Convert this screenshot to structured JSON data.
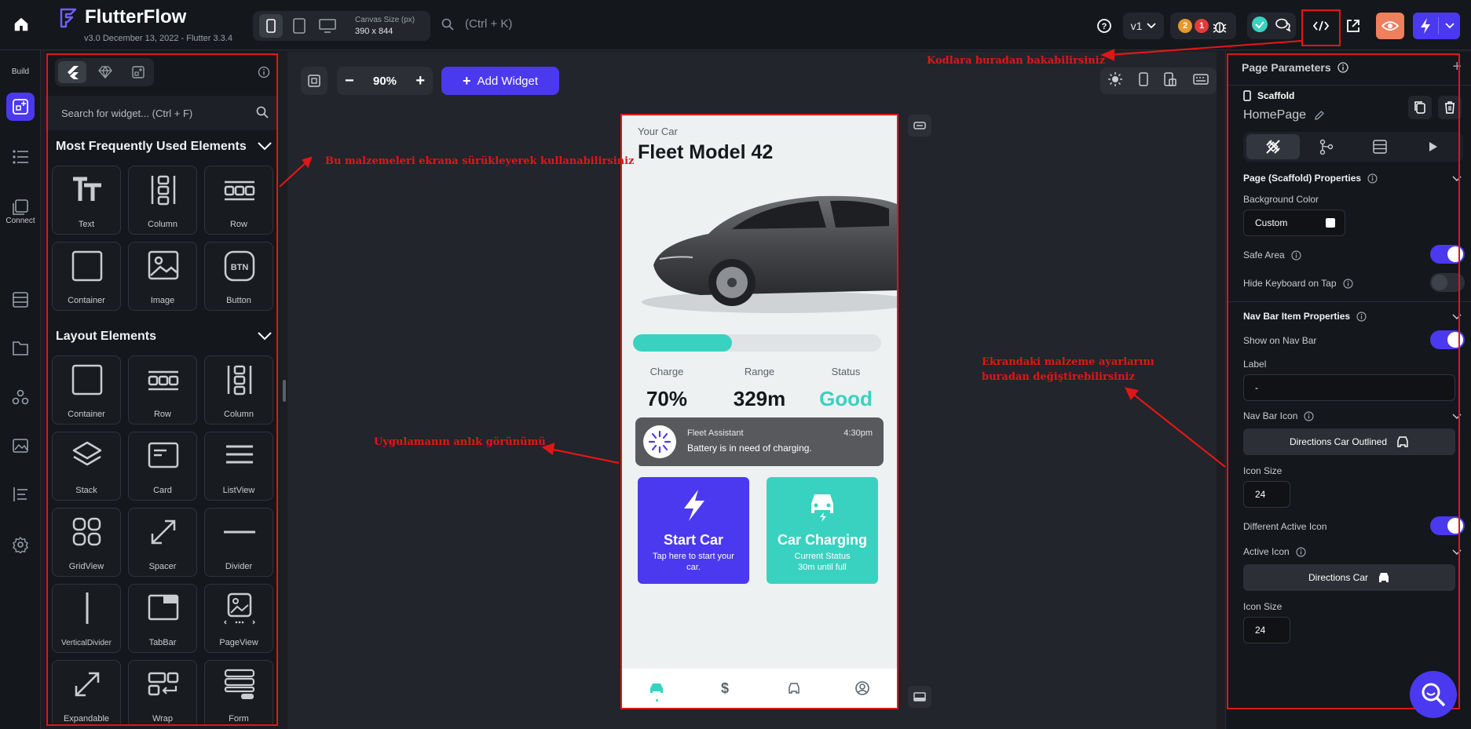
{
  "app": {
    "name": "FlutterFlow",
    "version": "v3.0 December 13, 2022 - Flutter 3.3.4"
  },
  "topbar": {
    "canvas_size_label": "Canvas Size (px)",
    "canvas_size_value": "390 x 844",
    "search_placeholder": "(Ctrl + K)",
    "version_pill": "v1",
    "warnings_count": "2",
    "errors_count": "1",
    "accent_color": "#4b39ef"
  },
  "rail": {
    "build_label": "Build",
    "connect_label": "Connect"
  },
  "widgets_panel": {
    "search_placeholder": "Search for widget...  (Ctrl + F)",
    "sections": [
      {
        "title": "Most Frequently Used Elements",
        "items": [
          "Text",
          "Column",
          "Row",
          "Container",
          "Image",
          "Button"
        ]
      },
      {
        "title": "Layout Elements",
        "items": [
          "Container",
          "Row",
          "Column",
          "Stack",
          "Card",
          "ListView",
          "GridView",
          "Spacer",
          "Divider",
          "VerticalDivider",
          "TabBar",
          "PageView",
          "Expandable",
          "Wrap",
          "Form"
        ]
      }
    ]
  },
  "canvas": {
    "zoom": "90%",
    "add_widget": "Add Widget"
  },
  "phone": {
    "subtitle": "Your Car",
    "title": "Fleet Model 42",
    "charge_progress_percent": 40,
    "stats": [
      {
        "label": "Charge",
        "value": "70%"
      },
      {
        "label": "Range",
        "value": "329m"
      },
      {
        "label": "Status",
        "value": "Good"
      }
    ],
    "notification": {
      "title": "Fleet Assistant",
      "time": "4:30pm",
      "message": "Battery is in need of charging."
    },
    "cards": [
      {
        "title": "Start Car",
        "subtitle": "Tap here to start your car.",
        "color": "#4b39ef"
      },
      {
        "title": "Car Charging",
        "subtitle": "Current Status\n30m until full",
        "color": "#39d2c0"
      }
    ]
  },
  "annotations": {
    "code": "Kodlara buradan bakabilirsiniz",
    "drag": "Bu malzemeleri ekrana sürükleyerek kullanabilirsiniz",
    "preview": "Uygulamanın anlık görünümü",
    "settings_line1": "Ekrandaki malzeme ayarlarını",
    "settings_line2": "buradan değiştirebilirsiniz"
  },
  "properties": {
    "header": "Page Parameters",
    "widget_type": "Scaffold",
    "page_name": "HomePage",
    "scaffold_section": "Page (Scaffold) Properties",
    "background_color_label": "Background Color",
    "background_color_value": "Custom",
    "safe_area_label": "Safe Area",
    "safe_area_on": true,
    "hide_keyboard_label": "Hide Keyboard on Tap",
    "hide_keyboard_on": false,
    "navbar_section": "Nav Bar Item Properties",
    "show_on_navbar_label": "Show on Nav Bar",
    "show_on_navbar_on": true,
    "label_label": "Label",
    "label_value": "-",
    "navbar_icon_label": "Nav Bar Icon",
    "navbar_icon_value": "Directions Car Outlined",
    "icon_size_label": "Icon Size",
    "icon_size_value": "24",
    "different_active_label": "Different Active Icon",
    "different_active_on": true,
    "active_icon_label": "Active Icon",
    "active_icon_value": "Directions Car",
    "active_icon_size_label": "Icon Size",
    "active_icon_size_value": "24"
  }
}
